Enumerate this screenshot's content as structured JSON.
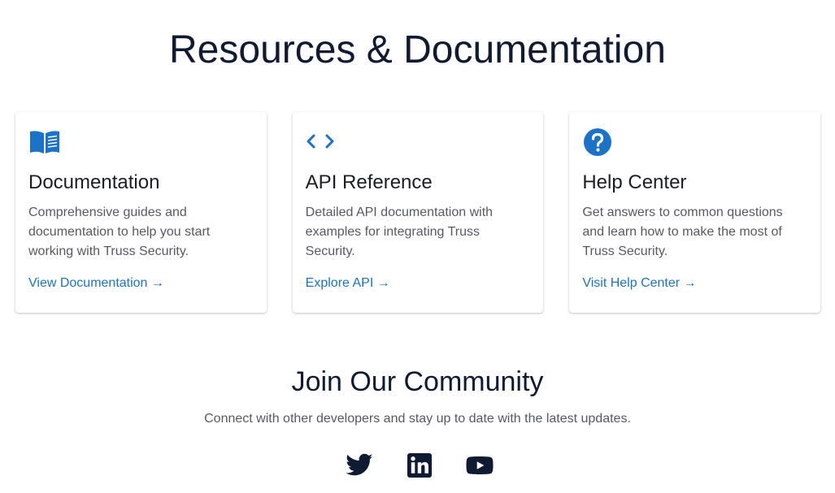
{
  "page": {
    "title": "Resources & Documentation"
  },
  "cards": [
    {
      "icon": "book-icon",
      "title": "Documentation",
      "description": "Comprehensive guides and documentation to help you start working with Truss Security.",
      "link": "View Documentation →"
    },
    {
      "icon": "code-icon",
      "title": "API Reference",
      "description": "Detailed API documentation with examples for integrating Truss Security.",
      "link": "Explore API →"
    },
    {
      "icon": "help-circle-icon",
      "title": "Help Center",
      "description": "Get answers to common questions and learn how to make the most of Truss Security.",
      "link": "Visit Help Center →"
    }
  ],
  "community": {
    "title": "Join Our Community",
    "subtitle": "Connect with other developers and stay up to date with the latest updates.",
    "socials": [
      "twitter-icon",
      "linkedin-icon",
      "youtube-icon"
    ]
  },
  "colors": {
    "accent": "#1a73c8",
    "heading": "#0f1a33",
    "body_text": "#555a61",
    "icon_dark": "#0f1a33"
  }
}
